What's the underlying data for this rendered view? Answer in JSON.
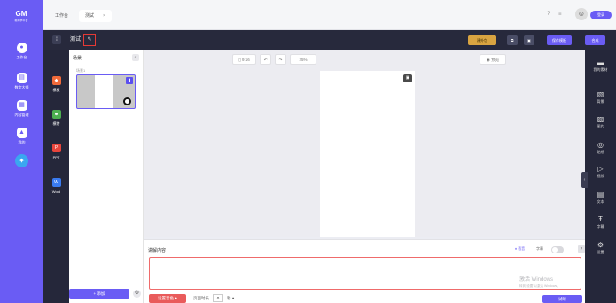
{
  "left_nav": {
    "logo_text": "GM",
    "logo_sub": "新商学平台",
    "items": [
      {
        "icon": "home-icon",
        "label": "工作台"
      },
      {
        "icon": "library-icon",
        "label": "数字大师"
      },
      {
        "icon": "content-icon",
        "label": "内容管理"
      },
      {
        "icon": "user-icon",
        "label": "我的"
      }
    ]
  },
  "tabs": [
    {
      "label": "工作台"
    },
    {
      "label": "测试",
      "close": "×"
    }
  ],
  "header_right": {
    "help": "?",
    "menu": "≡",
    "login": "登录"
  },
  "editor_header": {
    "title": "测试",
    "edit_icon": "✎",
    "buttons": {
      "share_label": "建外包",
      "copy_label": "⧉",
      "save_icon": "▣",
      "save_template_label": "保存模板",
      "generate_label": "合成"
    }
  },
  "left_tools": [
    {
      "icon": "template-icon",
      "label": "模板"
    },
    {
      "icon": "people-icon",
      "label": "模特"
    },
    {
      "icon": "ppt-icon",
      "label": "PPT"
    },
    {
      "icon": "word-icon",
      "label": "Word"
    }
  ],
  "scenes": {
    "title": "场景",
    "collapse": "«",
    "items": [
      {
        "label": "场景1"
      }
    ],
    "add_label": "+ 添加"
  },
  "canvas_toolbar": {
    "orientation": "9:16",
    "undo": "↶",
    "redo": "↷",
    "zoom": "25%",
    "preview": "◉ 预览"
  },
  "right_rail": [
    {
      "icon": "folder-icon",
      "label": "我的素材"
    },
    {
      "icon": "background-icon",
      "label": "背景"
    },
    {
      "icon": "image-icon",
      "label": "图片"
    },
    {
      "icon": "sticker-icon",
      "label": "贴纸"
    },
    {
      "icon": "video-icon",
      "label": "视频"
    },
    {
      "icon": "text-icon",
      "label": "文本"
    },
    {
      "icon": "subtitle-icon",
      "label": "字幕"
    },
    {
      "icon": "settings-icon",
      "label": "设置"
    }
  ],
  "narration": {
    "title": "讲解内容",
    "voice_label": "语音",
    "subtitle_label": "字幕",
    "close": "×",
    "setup_label": "设置音色",
    "duration_label": "页面时长",
    "duration_value": "0",
    "duration_unit": "秒",
    "try_label": "试听"
  },
  "watermark": {
    "line1": "激活 Windows",
    "line2": "转到\"设置\"以激活 Windows。"
  }
}
